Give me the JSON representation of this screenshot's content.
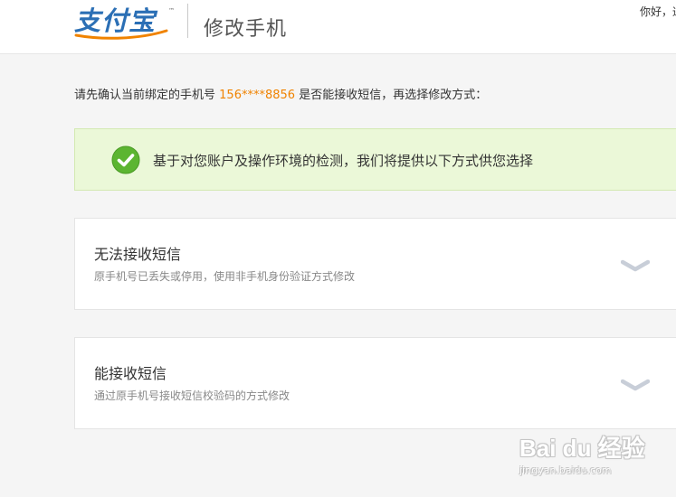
{
  "header": {
    "logo_text": "支付宝",
    "logo_tm": "™",
    "title": "修改手机",
    "greeting": "你好，通"
  },
  "confirm": {
    "prefix": "请先确认当前绑定的手机号",
    "phone": "156****8856",
    "suffix": "是否能接收短信，再选择修改方式："
  },
  "notice": {
    "icon": "check-circle-icon",
    "text": "基于对您账户及操作环境的检测，我们将提供以下方式供您选择"
  },
  "options": [
    {
      "title": "无法接收短信",
      "desc": "原手机号已丢失或停用，使用非手机身份验证方式修改",
      "icon": "chevron-down-icon"
    },
    {
      "title": "能接收短信",
      "desc": "通过原手机号接收短信校验码的方式修改",
      "icon": "chevron-down-icon"
    }
  ],
  "watermark": {
    "main": "Bai du 经验",
    "sub": "jingyan.baidu.com"
  },
  "colors": {
    "brand_blue": "#2b6fb5",
    "brand_orange": "#f08300",
    "notice_bg": "#ebf8d8",
    "check_green": "#5cb531"
  }
}
